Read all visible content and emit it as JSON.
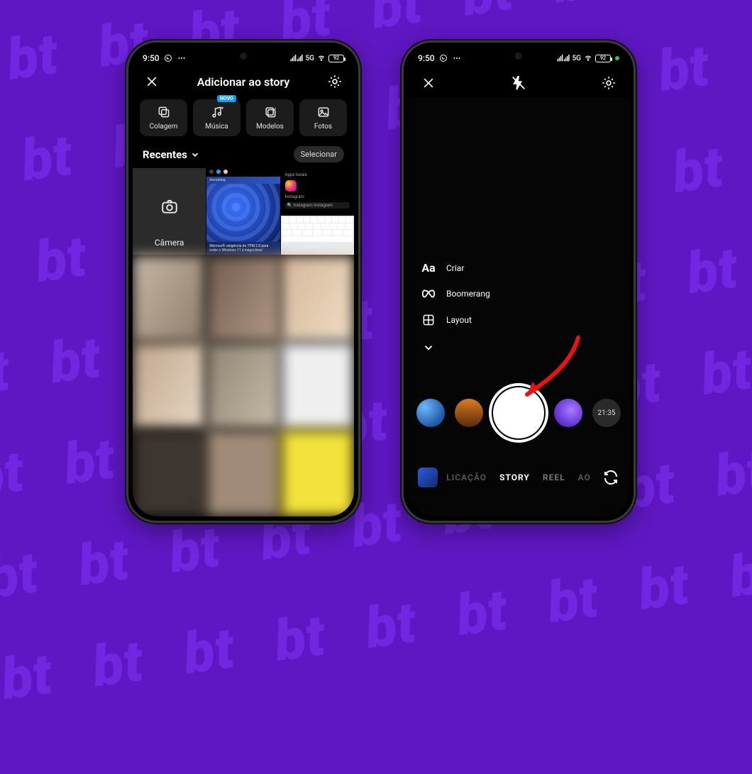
{
  "statusbar": {
    "time": "9:50",
    "network": "5G",
    "battery": "92"
  },
  "left": {
    "header": {
      "title": "Adicionar ao story"
    },
    "tabs": {
      "colagem": "Colagem",
      "musica": "Música",
      "musica_badge": "NOVO",
      "modelos": "Modelos",
      "fotos": "Fotos"
    },
    "recents_label": "Recentes",
    "select_label": "Selecionar",
    "camera_label": "Câmera",
    "thumb_caption": "Microsoft: exigência do TPM 2.0 para rodar o Windows 11 é inegociável",
    "thumb_brand": "tecnoblog",
    "thumb_apps": "Apps locais",
    "thumb_ig": "Instagram",
    "thumb_q": "Instagram   Instagram"
  },
  "right": {
    "options": {
      "criar": "Criar",
      "boomerang": "Boomerang",
      "layout": "Layout"
    },
    "lens5_label": "21:35",
    "modes": {
      "publicacao": "LICAÇÃO",
      "story": "STORY",
      "reel": "REEL",
      "ao": "AO"
    }
  }
}
